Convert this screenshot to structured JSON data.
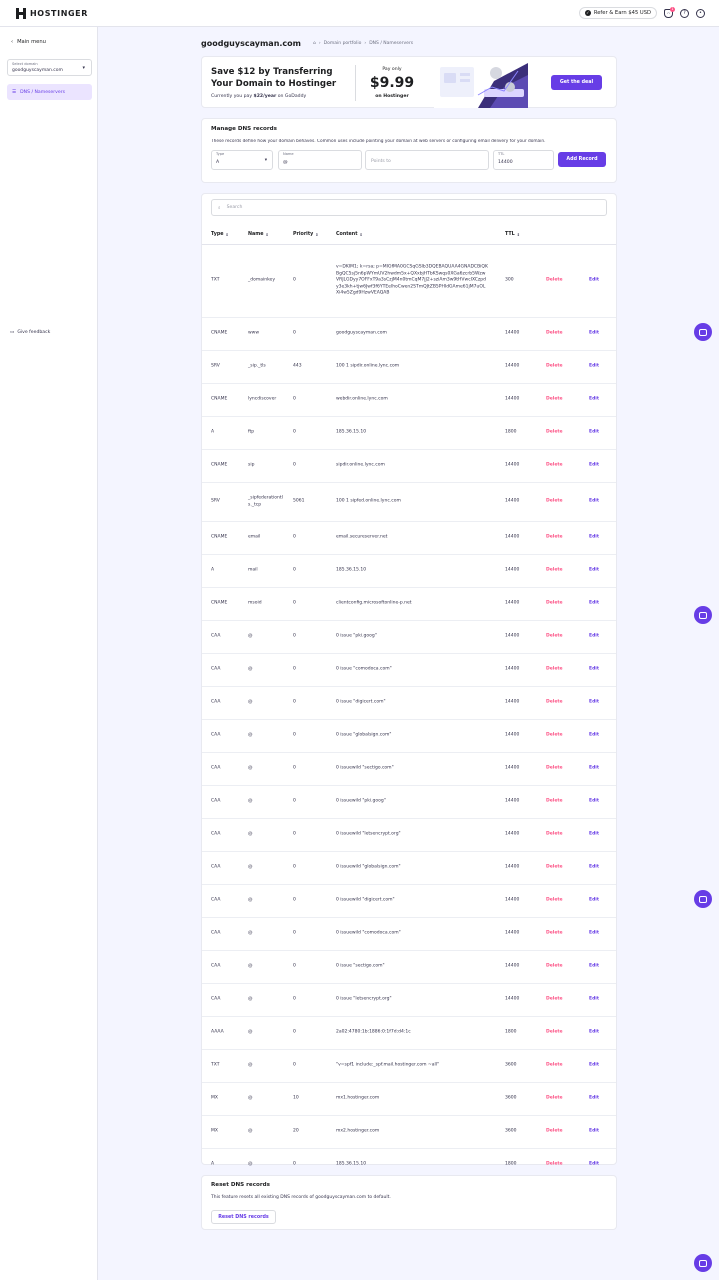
{
  "header": {
    "brand": "HOSTINGER",
    "refer_label": "Refer & Earn $45 USD",
    "notification_count": "1"
  },
  "sidebar": {
    "main_menu": "Main menu",
    "select_domain_label": "Select domain",
    "select_domain_value": "goodguyscayman.com",
    "active_item": "DNS / Nameservers",
    "feedback": "Give feedback"
  },
  "page": {
    "title": "goodguyscayman.com",
    "breadcrumb": [
      "Domain portfolio",
      "DNS / Nameservers"
    ]
  },
  "promo": {
    "title": "Save $12 by Transferring Your Domain to Hostinger",
    "subtitle_prefix": "Currently you pay",
    "subtitle_amount": "$22/year",
    "subtitle_suffix": "on GoDaddy",
    "pay_only": "Pay only",
    "price": "$9.99",
    "on_hostinger": "on Hostinger",
    "cta": "Get the deal"
  },
  "manage": {
    "title": "Manage DNS records",
    "description": "These records define how your domain behaves. Common uses include pointing your domain at web servers or configuring email delivery for your domain.",
    "type_label": "Type",
    "type_value": "A",
    "name_label": "Name",
    "name_value": "@",
    "points_placeholder": "Points to",
    "ttl_label": "TTL",
    "ttl_value": "14400",
    "add_button": "Add Record"
  },
  "records": {
    "search_placeholder": "Search",
    "columns": [
      "Type",
      "Name",
      "Priority",
      "Content",
      "TTL"
    ],
    "delete_label": "Delete",
    "edit_label": "Edit",
    "rows": [
      {
        "type": "TXT",
        "name": "_domainkey",
        "priority": "0",
        "content": "v=DKIM1; k=rsa; p=MIGfMA0GCSqGSIb3DQEBAQUAA4GNADCBiQKBgQC5sj5n6pWYmUV2hwdm5x+QXxbjHTbKSwqs0XGa6zcrb5WzwVRJLGDyy7OFFxT9a3sCzjM4n0tmCqM7jJ2+sziAm3w9tHVwcIXCzpdy3e3kh+tjw6Jwf3f6YTEelhoCwen2STmQJtZB5PHIdGAme61jM7uOLXi4w5Zgd9HzwVEAQAB",
        "ttl": "300",
        "h": 73
      },
      {
        "type": "CNAME",
        "name": "www",
        "priority": "0",
        "content": "goodguyscayman.com",
        "ttl": "14400",
        "h": 33
      },
      {
        "type": "SRV",
        "name": "_sip._tls",
        "priority": "443",
        "content": "100 1 sipdir.online.lync.com",
        "ttl": "14400",
        "h": 33
      },
      {
        "type": "CNAME",
        "name": "lyncdiscover",
        "priority": "0",
        "content": "webdir.online.lync.com",
        "ttl": "14400",
        "h": 33
      },
      {
        "type": "A",
        "name": "ftp",
        "priority": "0",
        "content": "185.36.15.10",
        "ttl": "1800",
        "h": 33
      },
      {
        "type": "CNAME",
        "name": "sip",
        "priority": "0",
        "content": "sipdir.online.lync.com",
        "ttl": "14400",
        "h": 33
      },
      {
        "type": "SRV",
        "name": "_sipfederationtls._tcp",
        "priority": "5061",
        "content": "100 1 sipfed.online.lync.com",
        "ttl": "14400",
        "h": 39
      },
      {
        "type": "CNAME",
        "name": "email",
        "priority": "0",
        "content": "email.secureserver.net",
        "ttl": "14400",
        "h": 33
      },
      {
        "type": "A",
        "name": "mail",
        "priority": "0",
        "content": "185.36.15.10",
        "ttl": "14400",
        "h": 33
      },
      {
        "type": "CNAME",
        "name": "msoid",
        "priority": "0",
        "content": "clientconfig.microsoftonline-p.net",
        "ttl": "14400",
        "h": 33
      },
      {
        "type": "CAA",
        "name": "@",
        "priority": "0",
        "content": "0 issue \"pki.goog\"",
        "ttl": "14400",
        "h": 33
      },
      {
        "type": "CAA",
        "name": "@",
        "priority": "0",
        "content": "0 issue \"comodoca.com\"",
        "ttl": "14400",
        "h": 33
      },
      {
        "type": "CAA",
        "name": "@",
        "priority": "0",
        "content": "0 issue \"digicert.com\"",
        "ttl": "14400",
        "h": 33
      },
      {
        "type": "CAA",
        "name": "@",
        "priority": "0",
        "content": "0 issue \"globalsign.com\"",
        "ttl": "14400",
        "h": 33
      },
      {
        "type": "CAA",
        "name": "@",
        "priority": "0",
        "content": "0 issuewild \"sectigo.com\"",
        "ttl": "14400",
        "h": 33
      },
      {
        "type": "CAA",
        "name": "@",
        "priority": "0",
        "content": "0 issuewild \"pki.goog\"",
        "ttl": "14400",
        "h": 33
      },
      {
        "type": "CAA",
        "name": "@",
        "priority": "0",
        "content": "0 issuewild \"letsencrypt.org\"",
        "ttl": "14400",
        "h": 33
      },
      {
        "type": "CAA",
        "name": "@",
        "priority": "0",
        "content": "0 issuewild \"globalsign.com\"",
        "ttl": "14400",
        "h": 33
      },
      {
        "type": "CAA",
        "name": "@",
        "priority": "0",
        "content": "0 issuewild \"digicert.com\"",
        "ttl": "14400",
        "h": 33
      },
      {
        "type": "CAA",
        "name": "@",
        "priority": "0",
        "content": "0 issuewild \"comodoca.com\"",
        "ttl": "14400",
        "h": 33
      },
      {
        "type": "CAA",
        "name": "@",
        "priority": "0",
        "content": "0 issue \"sectigo.com\"",
        "ttl": "14400",
        "h": 33
      },
      {
        "type": "CAA",
        "name": "@",
        "priority": "0",
        "content": "0 issue \"letsencrypt.org\"",
        "ttl": "14400",
        "h": 33
      },
      {
        "type": "AAAA",
        "name": "@",
        "priority": "0",
        "content": "2a02:4780:1b:1886:0:1f7d:d4:1c",
        "ttl": "1800",
        "h": 33
      },
      {
        "type": "TXT",
        "name": "@",
        "priority": "0",
        "content": "\"v=spf1 include:_spf.mail.hostinger.com ~all\"",
        "ttl": "3600",
        "h": 33
      },
      {
        "type": "MX",
        "name": "@",
        "priority": "10",
        "content": "mx1.hostinger.com",
        "ttl": "3600",
        "h": 33
      },
      {
        "type": "MX",
        "name": "@",
        "priority": "20",
        "content": "mx2.hostinger.com",
        "ttl": "3600",
        "h": 33
      },
      {
        "type": "A",
        "name": "@",
        "priority": "0",
        "content": "185.36.15.10",
        "ttl": "1800",
        "h": 33
      }
    ]
  },
  "reset": {
    "title": "Reset DNS records",
    "description": "This feature resets all existing DNS records of goodguyscayman.com to default.",
    "button": "Reset DNS records"
  },
  "colors": {
    "accent": "#673de6",
    "danger": "#fc5185",
    "background": "#f4f5ff"
  }
}
